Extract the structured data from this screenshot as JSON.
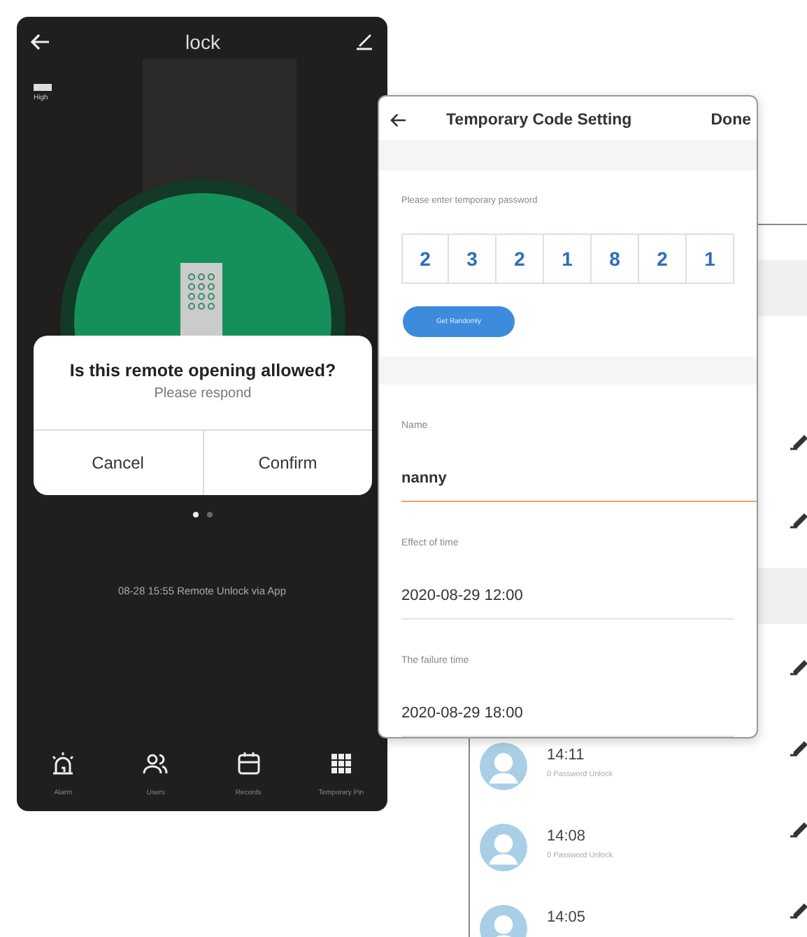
{
  "lock_screen": {
    "title": "lock",
    "battery_label": "High",
    "dialog": {
      "title": "Is this remote opening allowed?",
      "message": "Please respond",
      "buttons": [
        "Cancel",
        "Confirm"
      ]
    },
    "pager": [
      {
        "selected": true
      },
      {
        "selected": false
      }
    ],
    "last_event": "08-28 15:55 Remote Unlock via App",
    "nav": [
      {
        "kind": "alarm",
        "label": "Alarm"
      },
      {
        "kind": "users",
        "label": "Users"
      },
      {
        "kind": "records",
        "label": "Records"
      },
      {
        "kind": "pin",
        "label": "Temporary Pin"
      }
    ]
  },
  "code_setting": {
    "title": "Temporary Code Setting",
    "done": "Done",
    "prompt": "Please enter temporary password",
    "digits": [
      "2",
      "3",
      "2",
      "1",
      "8",
      "2",
      "1"
    ],
    "random_button": "Get Randomly",
    "fields": [
      {
        "label": "Name",
        "value": "nanny",
        "focused": true
      },
      {
        "label": "Effect of time",
        "value": "2020-08-29 12:00",
        "focused": false
      },
      {
        "label": "The failure time",
        "value": "2020-08-29 18:00",
        "focused": false
      }
    ]
  },
  "records": {
    "rows": [
      {
        "time": "14:11",
        "detail": "0 Password Unlock"
      },
      {
        "time": "14:08",
        "detail": "0 Password Unlock"
      },
      {
        "time": "14:05"
      }
    ]
  }
}
